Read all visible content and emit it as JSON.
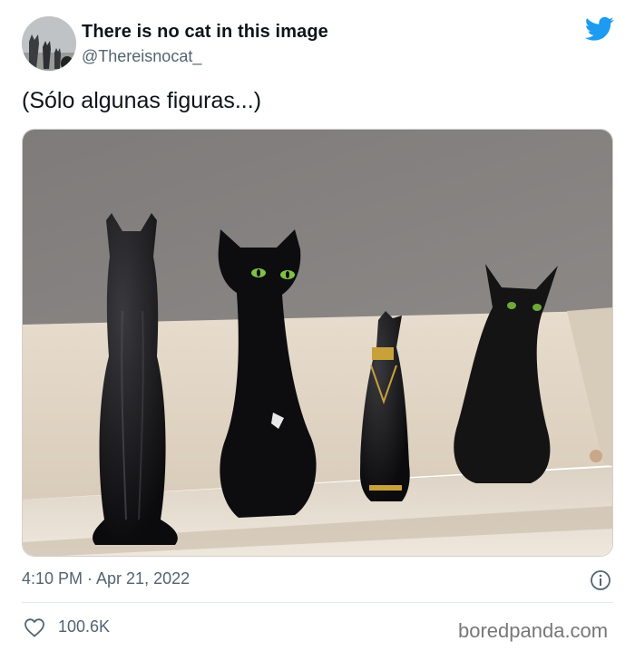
{
  "author": {
    "display_name": "There is no cat in this image",
    "handle": "@Thereisnocat_",
    "avatar_icon": "cat-avatar"
  },
  "tweet": {
    "text": "(Sólo algunas figuras...)",
    "timestamp": "4:10 PM · Apr 21, 2022",
    "likes": "100.6K"
  },
  "watermark": "boredpanda.com",
  "icons": {
    "brand": "twitter-bird-icon",
    "info": "info-icon",
    "like": "heart-icon"
  },
  "colors": {
    "brand": "#1d9bf0",
    "secondary_text": "#536471",
    "primary_text": "#0f1419"
  }
}
